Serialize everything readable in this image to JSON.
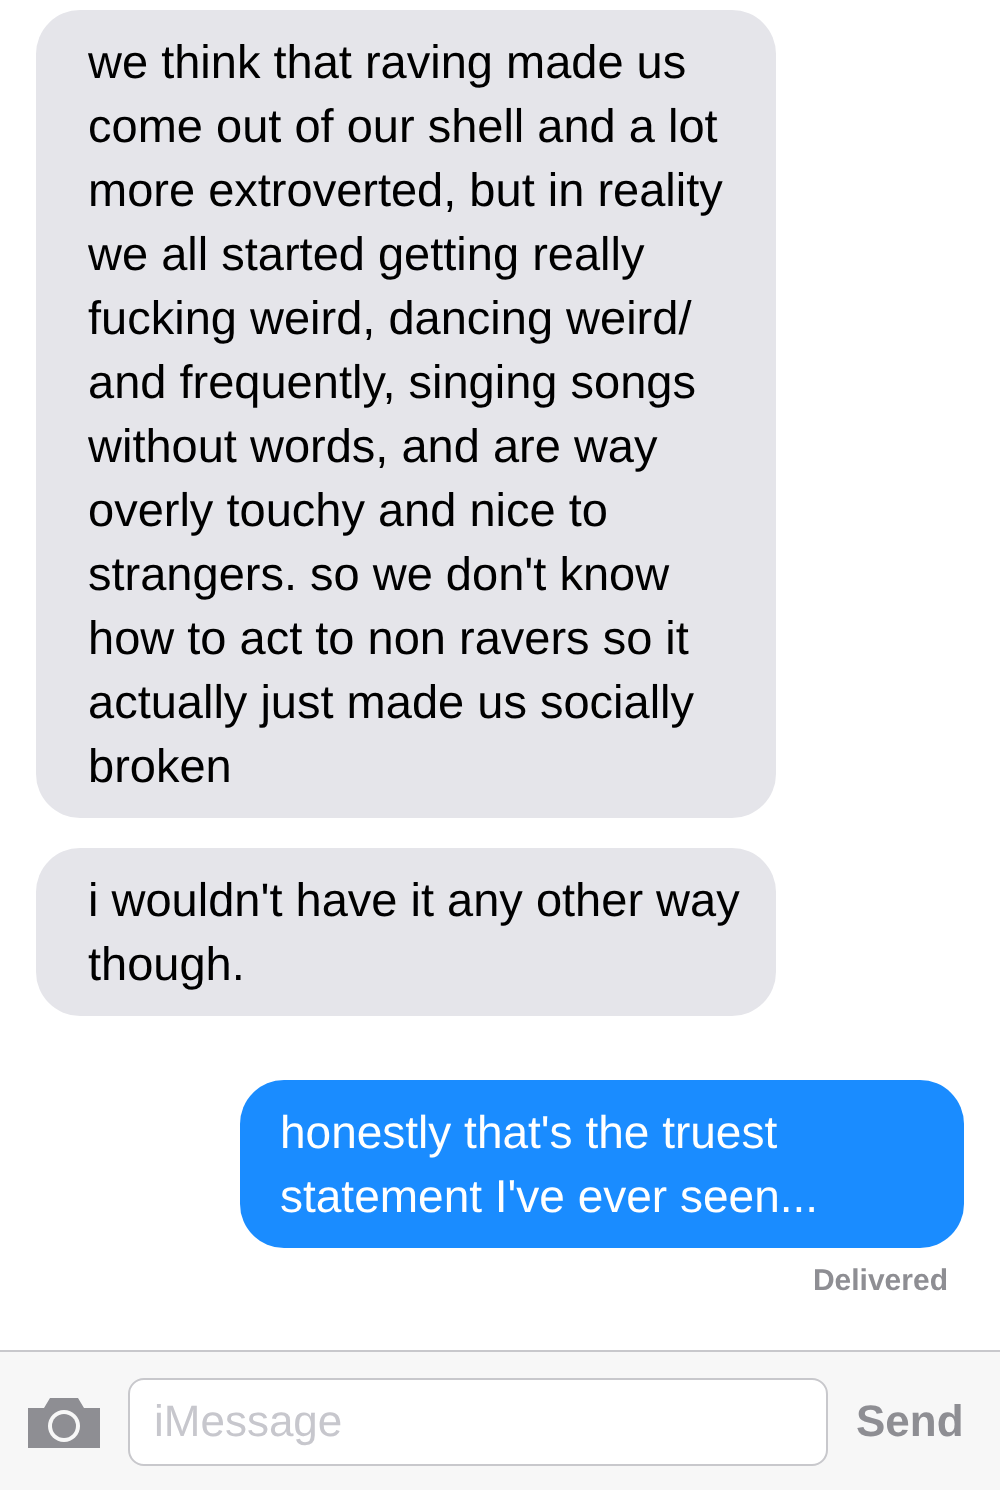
{
  "messages": [
    {
      "text": "we think that raving made us come out of our shell and a lot more extroverted, but in reality we all started getting really fucking weird, dancing weird/ and frequently, singing songs without words, and are way overly touchy and nice to strangers. so we don't know how to act to non ravers so it actually just made us socially broken",
      "sent": false
    },
    {
      "text": "i wouldn't have it any other way though.",
      "sent": false
    },
    {
      "text": "honestly that's the truest statement I've ever seen...",
      "sent": true
    }
  ],
  "status": "Delivered",
  "composer": {
    "placeholder": "iMessage",
    "send": "Send",
    "send_disabled": true
  }
}
